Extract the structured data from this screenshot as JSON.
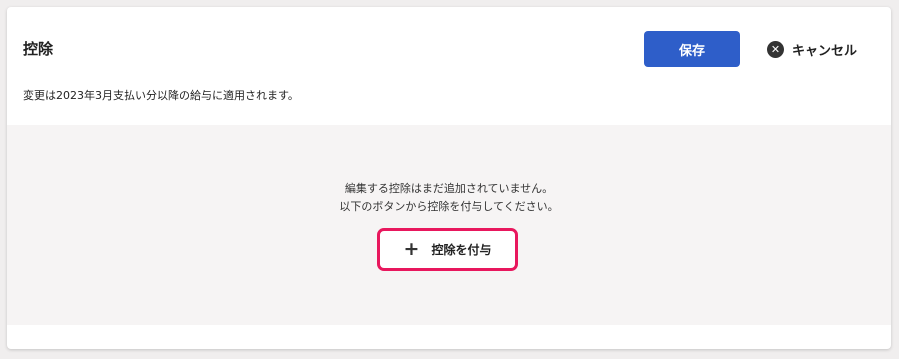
{
  "panel": {
    "title": "控除",
    "save_label": "保存",
    "cancel_label": "キャンセル",
    "note": "変更は2023年3月支払い分以降の給与に適用されます。"
  },
  "empty_state": {
    "line1": "編集する控除はまだ追加されていません。",
    "line2": "以下のボタンから控除を付与してください。",
    "add_label": "控除を付与"
  },
  "icons": {
    "cancel": "close-circle-icon",
    "add": "plus-icon"
  },
  "colors": {
    "primary": "#2e5ec9",
    "highlight": "#e8175d"
  }
}
